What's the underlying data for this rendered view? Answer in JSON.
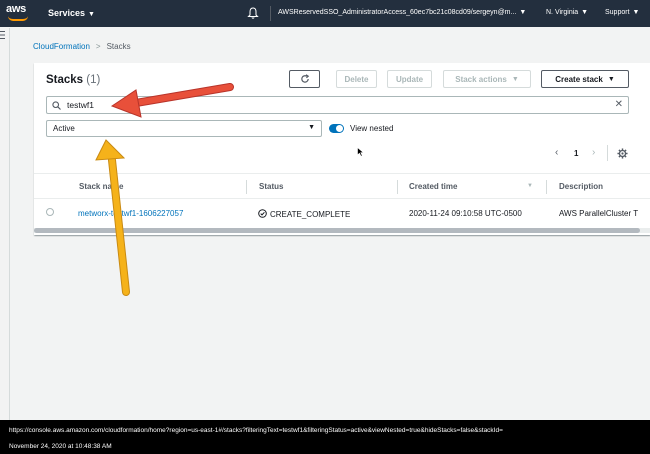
{
  "nav": {
    "logo_text": "aws",
    "services_label": "Services",
    "account_label": "AWSReservedSSO_AdministratorAccess_60ec7bc21c08cd09/sergeyn@m...",
    "region_label": "N. Virginia",
    "support_label": "Support"
  },
  "breadcrumb": {
    "parent": "CloudFormation",
    "current": "Stacks"
  },
  "panel": {
    "title": "Stacks",
    "count": "(1)",
    "buttons": {
      "delete": "Delete",
      "update": "Update",
      "stack_actions": "Stack actions",
      "create_stack": "Create stack"
    },
    "search_value": "testwf1",
    "filter_value": "Active",
    "view_nested_label": "View nested",
    "view_nested_on": true,
    "page_number": "1"
  },
  "table": {
    "columns": [
      "Stack name",
      "Status",
      "Created time",
      "Description"
    ],
    "rows": [
      {
        "stack_name": "metworx-testwf1-1606227057",
        "status": "CREATE_COMPLETE",
        "created_time": "2020-11-24 09:10:58 UTC-0500",
        "description": "AWS ParallelCluster T"
      }
    ]
  },
  "footer": {
    "url": "https://console.aws.amazon.com/cloudformation/home?region=us-east-1#/stacks?filteringText=testwf1&filteringStatus=active&viewNested=true&hideStacks=false&stackId=",
    "timestamp": "November 24, 2020 at 10:48:38 AM"
  },
  "colors": {
    "nav_bg": "#232f3e",
    "link": "#0073bb",
    "accent": "#ff9900",
    "annotation_red": "#e8503a",
    "annotation_yellow": "#f5b21a"
  },
  "icons": [
    "caret-down-icon",
    "bell-icon",
    "menu-icon",
    "refresh-icon",
    "search-icon",
    "clear-icon",
    "chevron-left-icon",
    "chevron-right-icon",
    "gear-icon",
    "check-circle-icon",
    "cursor-icon"
  ]
}
